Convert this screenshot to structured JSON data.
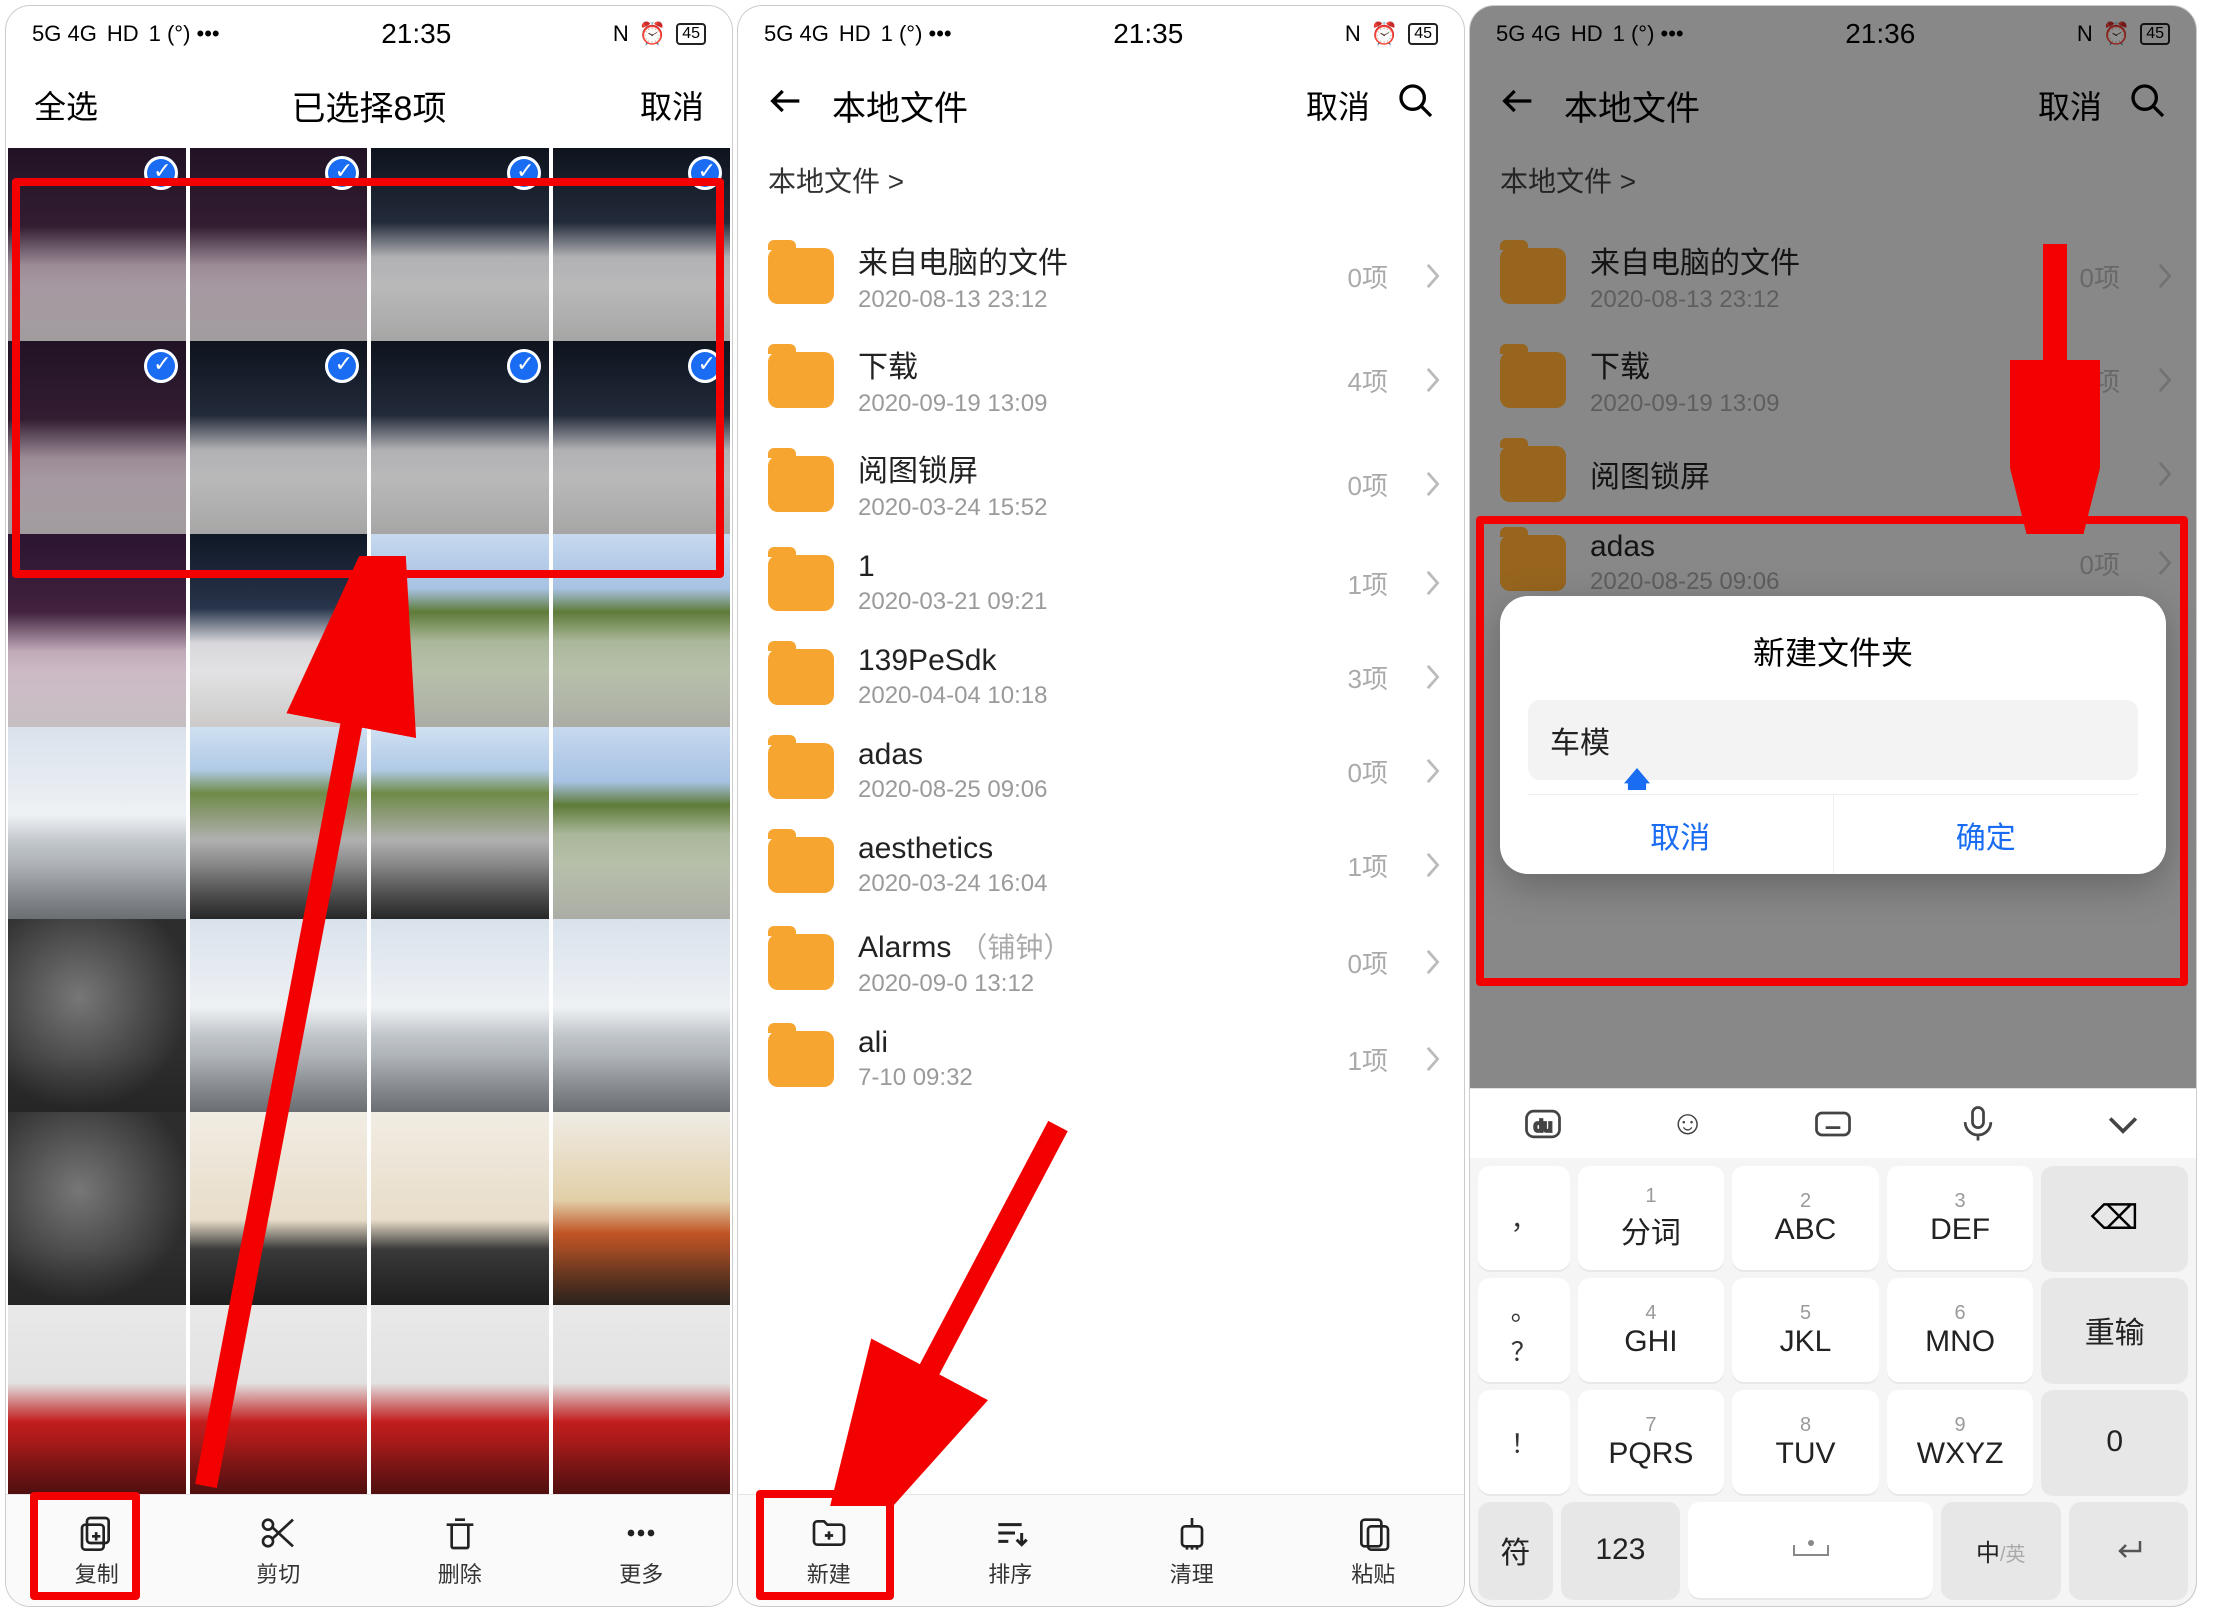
{
  "status": {
    "net": "5G 4G",
    "hd": "HD",
    "t1": "21:35",
    "t2": "21:35",
    "t3": "21:36",
    "batt": "45"
  },
  "screen1": {
    "left": "全选",
    "title": "已选择8项",
    "right": "取消",
    "toolbar": [
      "复制",
      "剪切",
      "删除",
      "更多"
    ]
  },
  "screen2": {
    "title": "本地文件",
    "cancel": "取消",
    "breadcrumb": "本地文件 >",
    "items": [
      {
        "name": "来自电脑的文件",
        "sub": "2020-08-13 23:12",
        "count": "0项"
      },
      {
        "name": "下载",
        "sub": "2020-09-19 13:09",
        "count": "4项"
      },
      {
        "name": "阅图锁屏",
        "sub": "2020-03-24 15:52",
        "count": "0项"
      },
      {
        "name": "1",
        "sub": "2020-03-21 09:21",
        "count": "1项"
      },
      {
        "name": "139PeSdk",
        "sub": "2020-04-04 10:18",
        "count": "3项"
      },
      {
        "name": "adas",
        "sub": "2020-08-25 09:06",
        "count": "0项"
      },
      {
        "name": "aesthetics",
        "sub": "2020-03-24 16:04",
        "count": "1项"
      },
      {
        "name": "Alarms",
        "extra": "（铺钟）",
        "sub": "2020-09-0   13:12",
        "count": "0项"
      },
      {
        "name": "ali",
        "sub": "             7-10 09:32",
        "count": "1项"
      }
    ],
    "toolbar": [
      "新建",
      "排序",
      "清理",
      "粘贴"
    ]
  },
  "screen3": {
    "title": "本地文件",
    "cancel": "取消",
    "breadcrumb": "本地文件 >",
    "items": [
      {
        "name": "来自电脑的文件",
        "sub": "2020-08-13 23:12",
        "count": "0项"
      },
      {
        "name": "下载",
        "sub": "2020-09-19 13:09",
        "count": "4项"
      },
      {
        "name": "阅图锁屏",
        "sub": "",
        "count": ""
      },
      {
        "name": "adas",
        "sub": "2020-08-25 09:06",
        "count": "0项"
      }
    ],
    "dialog": {
      "title": "新建文件夹",
      "value": "车模",
      "cancel": "取消",
      "ok": "确定"
    },
    "kb": {
      "row1": [
        "，",
        {
          "n": "1",
          "l": "分词"
        },
        {
          "n": "2",
          "l": "ABC"
        },
        {
          "n": "3",
          "l": "DEF"
        }
      ],
      "row2": [
        "。",
        {
          "n": "4",
          "l": "GHI"
        },
        {
          "n": "5",
          "l": "JKL"
        },
        {
          "n": "6",
          "l": "MNO"
        }
      ],
      "r2punct": "？",
      "row3": [
        "！",
        {
          "n": "7",
          "l": "PQRS"
        },
        {
          "n": "8",
          "l": "TUV"
        },
        {
          "n": "9",
          "l": "WXYZ"
        }
      ],
      "side": [
        "⌫",
        "重输",
        "0"
      ],
      "bottom": [
        "符",
        "123",
        "",
        "中/英",
        ""
      ]
    }
  }
}
